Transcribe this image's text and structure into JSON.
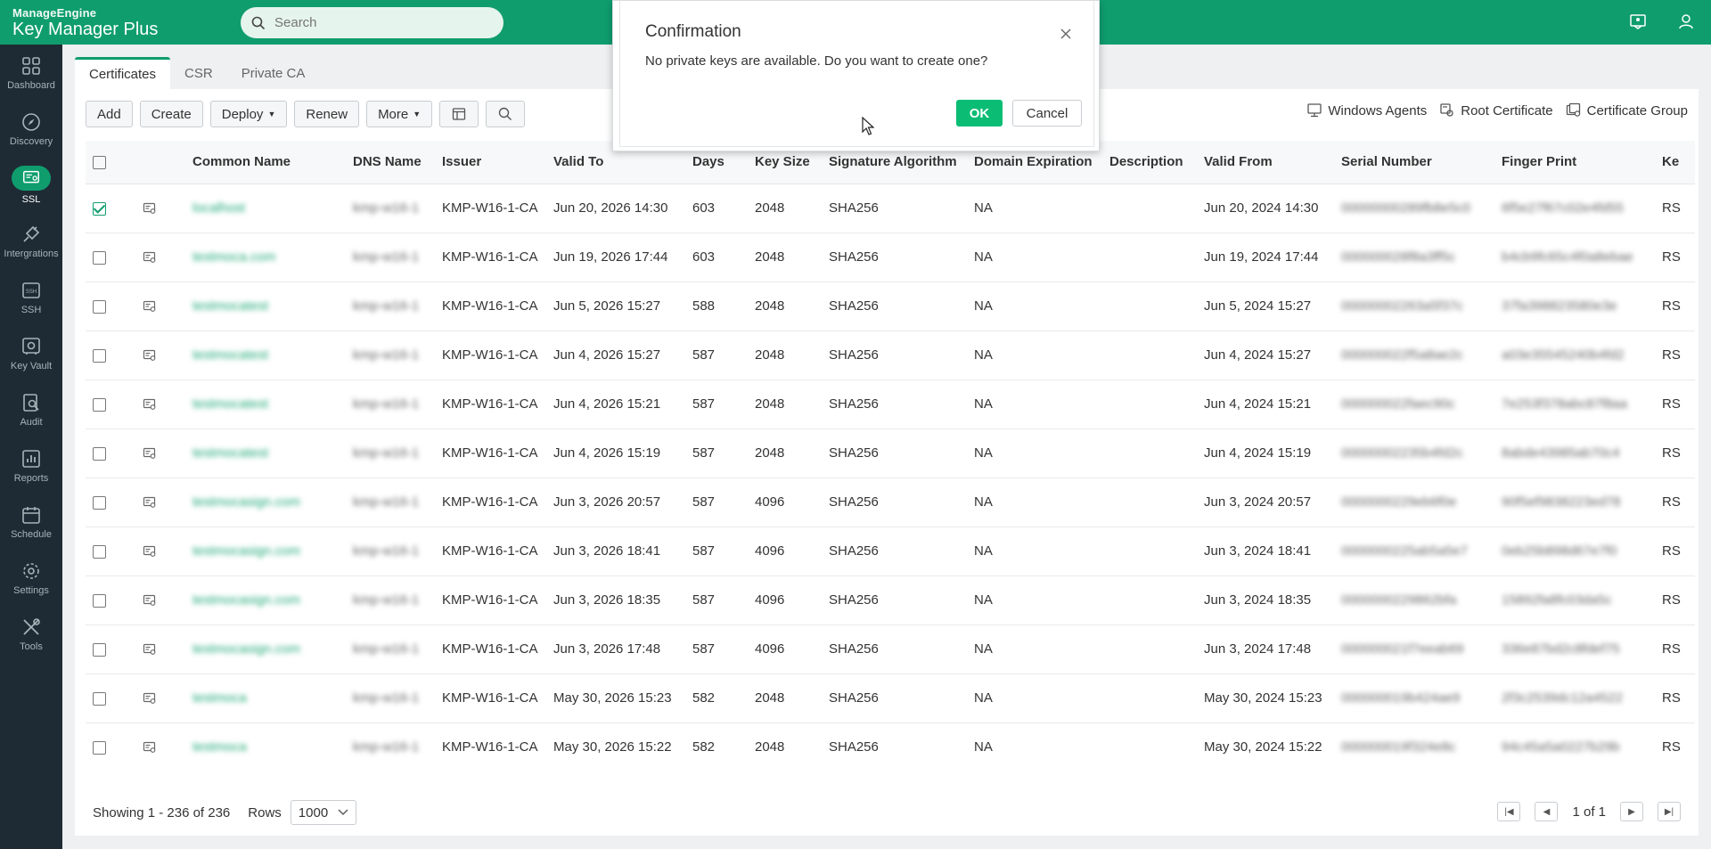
{
  "topbar": {
    "vendor": "ManageEngine",
    "product": "Key Manager Plus",
    "search_placeholder": "Search",
    "icons": [
      "chat-icon",
      "user-icon"
    ]
  },
  "sidebar": {
    "items": [
      {
        "label": "Dashboard",
        "icon": "dashboard-icon"
      },
      {
        "label": "Discovery",
        "icon": "compass-icon"
      },
      {
        "label": "SSL",
        "icon": "certificate-icon",
        "active": true
      },
      {
        "label": "Intergrations",
        "icon": "plug-icon"
      },
      {
        "label": "SSH",
        "icon": "ssh-icon"
      },
      {
        "label": "Key Vault",
        "icon": "vault-icon"
      },
      {
        "label": "Audit",
        "icon": "audit-icon"
      },
      {
        "label": "Reports",
        "icon": "reports-icon"
      },
      {
        "label": "Schedule",
        "icon": "calendar-icon"
      },
      {
        "label": "Settings",
        "icon": "gear-icon"
      },
      {
        "label": "Tools",
        "icon": "tools-icon"
      }
    ]
  },
  "tabs": [
    "Certificates",
    "CSR",
    "Private CA"
  ],
  "toolbar": {
    "add": "Add",
    "create": "Create",
    "deploy": "Deploy",
    "renew": "Renew",
    "more": "More"
  },
  "right_links": [
    "Windows Agents",
    "Root Certificate",
    "Certificate Group"
  ],
  "table": {
    "columns": [
      "Common Name",
      "DNS Name",
      "Issuer",
      "Valid To",
      "Days",
      "Key Size",
      "Signature Algorithm",
      "Domain Expiration",
      "Description",
      "Valid From",
      "Serial Number",
      "Finger Print",
      "Ke"
    ],
    "rows": [
      {
        "checked": true,
        "cn": "localhost",
        "dns": "kmp-w16-1",
        "issuer": "KMP-W16-1-CA",
        "valid_to": "Jun 20, 2026 14:30",
        "days": "603",
        "key_size": "2048",
        "sig": "SHA256",
        "domain_exp": "NA",
        "desc": "",
        "valid_from": "Jun 20, 2024 14:30",
        "serial": "00000000289fb8e5c0",
        "finger": "6f5e27f67c02e4fd55",
        "ke": "RS"
      },
      {
        "checked": false,
        "cn": "testmoca.com",
        "dns": "kmp-w16-1",
        "issuer": "KMP-W16-1-CA",
        "valid_to": "Jun 19, 2026 17:44",
        "days": "603",
        "key_size": "2048",
        "sig": "SHA256",
        "domain_exp": "NA",
        "desc": "",
        "valid_from": "Jun 19, 2024 17:44",
        "serial": "000000028f8a3ff5c",
        "finger": "b4cb9fc65c4f0a8ebae",
        "ke": "RS"
      },
      {
        "checked": false,
        "cn": "testmocatest",
        "dns": "kmp-w16-1",
        "issuer": "KMP-W16-1-CA",
        "valid_to": "Jun 5, 2026 15:27",
        "days": "588",
        "key_size": "2048",
        "sig": "SHA256",
        "domain_exp": "NA",
        "desc": "",
        "valid_from": "Jun 5, 2024 15:27",
        "serial": "00000002263a5f37c",
        "finger": "37fa398823580e3e",
        "ke": "RS"
      },
      {
        "checked": false,
        "cn": "testmocatest",
        "dns": "kmp-w16-1",
        "issuer": "KMP-W16-1-CA",
        "valid_to": "Jun 4, 2026 15:27",
        "days": "587",
        "key_size": "2048",
        "sig": "SHA256",
        "domain_exp": "NA",
        "desc": "",
        "valid_from": "Jun 4, 2024 15:27",
        "serial": "000000022f5a8ae2c",
        "finger": "a03e35545240b4fd2",
        "ke": "RS"
      },
      {
        "checked": false,
        "cn": "testmocatest",
        "dns": "kmp-w16-1",
        "issuer": "KMP-W16-1-CA",
        "valid_to": "Jun 4, 2026 15:21",
        "days": "587",
        "key_size": "2048",
        "sig": "SHA256",
        "domain_exp": "NA",
        "desc": "",
        "valid_from": "Jun 4, 2024 15:21",
        "serial": "000000022faec90c",
        "finger": "7e253f378abc87f8aa",
        "ke": "RS"
      },
      {
        "checked": false,
        "cn": "testmocatest",
        "dns": "kmp-w16-1",
        "issuer": "KMP-W16-1-CA",
        "valid_to": "Jun 4, 2026 15:19",
        "days": "587",
        "key_size": "2048",
        "sig": "SHA256",
        "domain_exp": "NA",
        "desc": "",
        "valid_from": "Jun 4, 2024 15:19",
        "serial": "00000002235b4fd2c",
        "finger": "8abde43985ab70c4",
        "ke": "RS"
      },
      {
        "checked": false,
        "cn": "testmocasign.com",
        "dns": "kmp-w16-1",
        "issuer": "KMP-W16-1-CA",
        "valid_to": "Jun 3, 2026 20:57",
        "days": "587",
        "key_size": "4096",
        "sig": "SHA256",
        "domain_exp": "NA",
        "desc": "",
        "valid_from": "Jun 3, 2024 20:57",
        "serial": "0000000229eb6f0e",
        "finger": "90f5ef9838223ed78",
        "ke": "RS"
      },
      {
        "checked": false,
        "cn": "testmocasign.com",
        "dns": "kmp-w16-1",
        "issuer": "KMP-W16-1-CA",
        "valid_to": "Jun 3, 2026 18:41",
        "days": "587",
        "key_size": "4096",
        "sig": "SHA256",
        "domain_exp": "NA",
        "desc": "",
        "valid_from": "Jun 3, 2024 18:41",
        "serial": "0000000225ab5a5e7",
        "finger": "0eb25b898d67e7f0",
        "ke": "RS"
      },
      {
        "checked": false,
        "cn": "testmocasign.com",
        "dns": "kmp-w16-1",
        "issuer": "KMP-W16-1-CA",
        "valid_to": "Jun 3, 2026 18:35",
        "days": "587",
        "key_size": "4096",
        "sig": "SHA256",
        "domain_exp": "NA",
        "desc": "",
        "valid_from": "Jun 3, 2024 18:35",
        "serial": "0000000229862bfa",
        "finger": "15892fa8fc03da5c",
        "ke": "RS"
      },
      {
        "checked": false,
        "cn": "testmocasign.com",
        "dns": "kmp-w16-1",
        "issuer": "KMP-W16-1-CA",
        "valid_to": "Jun 3, 2026 17:48",
        "days": "587",
        "key_size": "4096",
        "sig": "SHA256",
        "domain_exp": "NA",
        "desc": "",
        "valid_from": "Jun 3, 2024 17:48",
        "serial": "000000021f7eeab69",
        "finger": "336e87bd2c8fdef75",
        "ke": "RS"
      },
      {
        "checked": false,
        "cn": "testmoca",
        "dns": "kmp-w16-1",
        "issuer": "KMP-W16-1-CA",
        "valid_to": "May 30, 2026 15:23",
        "days": "582",
        "key_size": "2048",
        "sig": "SHA256",
        "domain_exp": "NA",
        "desc": "",
        "valid_from": "May 30, 2024 15:23",
        "serial": "000000019b424ae9",
        "finger": "2f3c2539dc12a4522",
        "ke": "RS"
      },
      {
        "checked": false,
        "cn": "testmoca",
        "dns": "kmp-w16-1",
        "issuer": "KMP-W16-1-CA",
        "valid_to": "May 30, 2026 15:22",
        "days": "582",
        "key_size": "2048",
        "sig": "SHA256",
        "domain_exp": "NA",
        "desc": "",
        "valid_from": "May 30, 2024 15:22",
        "serial": "000000019f324e8c",
        "finger": "94c45a5a0227b29b",
        "ke": "RS"
      }
    ]
  },
  "footer": {
    "showing": "Showing 1 - 236 of 236",
    "rows_label": "Rows",
    "rows_value": "1000",
    "page": "1 of 1"
  },
  "modal": {
    "title": "Confirmation",
    "message": "No private keys are available. Do you want to create one?",
    "ok": "OK",
    "cancel": "Cancel"
  },
  "colors": {
    "brand": "#0f9d6e",
    "sidebar": "#1f2b34",
    "ok_button": "#0bbd74"
  }
}
